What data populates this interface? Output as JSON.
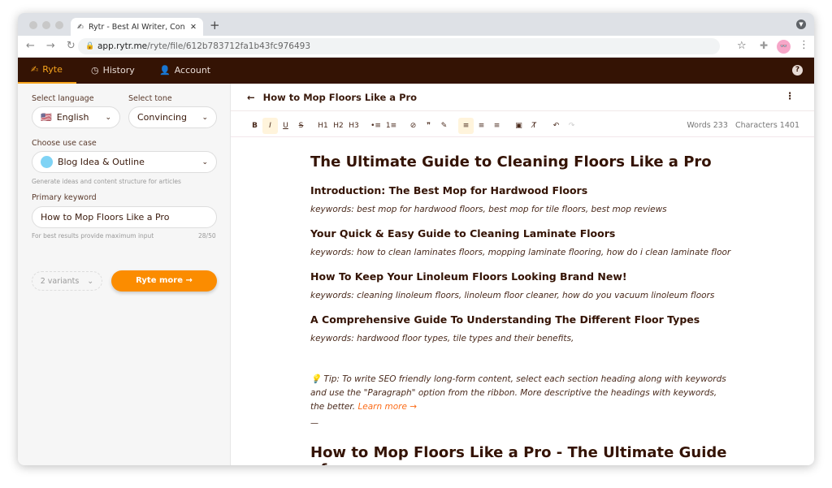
{
  "browser": {
    "tab_title": "Rytr - Best AI Writer, Content Generator & Writing Assistant",
    "url_host": "app.rytr.me",
    "url_path": "/ryte/file/612b783712fa1b43fc976493"
  },
  "appnav": {
    "items": [
      {
        "label": "Ryte",
        "icon": "writing-hand-icon"
      },
      {
        "label": "History",
        "icon": "history-icon"
      },
      {
        "label": "Account",
        "icon": "user-icon"
      }
    ],
    "accent": "#f7a41d",
    "bg": "#341304"
  },
  "sidebar": {
    "language_label": "Select language",
    "language_value": "English",
    "tone_label": "Select tone",
    "tone_value": "Convincing",
    "usecase_label": "Choose use case",
    "usecase_value": "Blog Idea & Outline",
    "usecase_hint": "Generate ideas and content structure for articles",
    "keyword_label": "Primary keyword",
    "keyword_value": "How to Mop Floors Like a Pro",
    "keyword_hint": "For best results provide maximum input",
    "keyword_count": "28/50",
    "variants": "2 variants",
    "ryte_button": "Ryte more →"
  },
  "editor": {
    "title": "How to Mop Floors Like a Pro",
    "toolbar": [
      "B",
      "I",
      "U",
      "S",
      "H1",
      "H2",
      "H3",
      "•≡",
      "1≡",
      "⊘",
      "❞",
      "✎",
      "≡",
      "≡",
      "≡",
      "▣",
      "T̸",
      "↶",
      "↷"
    ],
    "words": "Words 233",
    "characters": "Characters 1401",
    "doc_title": "The Ultimate Guide to Cleaning Floors Like a Pro",
    "sections": [
      {
        "heading": "Introduction: The Best Mop for Hardwood Floors",
        "keywords": "keywords: best mop for hardwood floors, best mop for tile floors, best mop reviews"
      },
      {
        "heading": "Your Quick & Easy Guide to Cleaning Laminate Floors",
        "keywords": "keywords: how to clean laminates floors, mopping laminate flooring, how do i clean laminate floor"
      },
      {
        "heading": "How To Keep Your Linoleum Floors Looking Brand New!",
        "keywords": "keywords: cleaning linoleum floors, linoleum floor cleaner, how do you vacuum linoleum floors"
      },
      {
        "heading": "A Comprehensive Guide To Understanding The Different Floor Types",
        "keywords": "keywords: hardwood floor types, tile types and their benefits,"
      }
    ],
    "tip": "💡 Tip: To write SEO friendly long-form content, select each section heading along with keywords and use the \"Paragraph\" option from the ribbon. More descriptive the headings with keywords, the better.",
    "learn_more": "Learn more →",
    "separator": "—",
    "next_heading": "How to Mop Floors Like a Pro - The Ultimate Guide of"
  }
}
